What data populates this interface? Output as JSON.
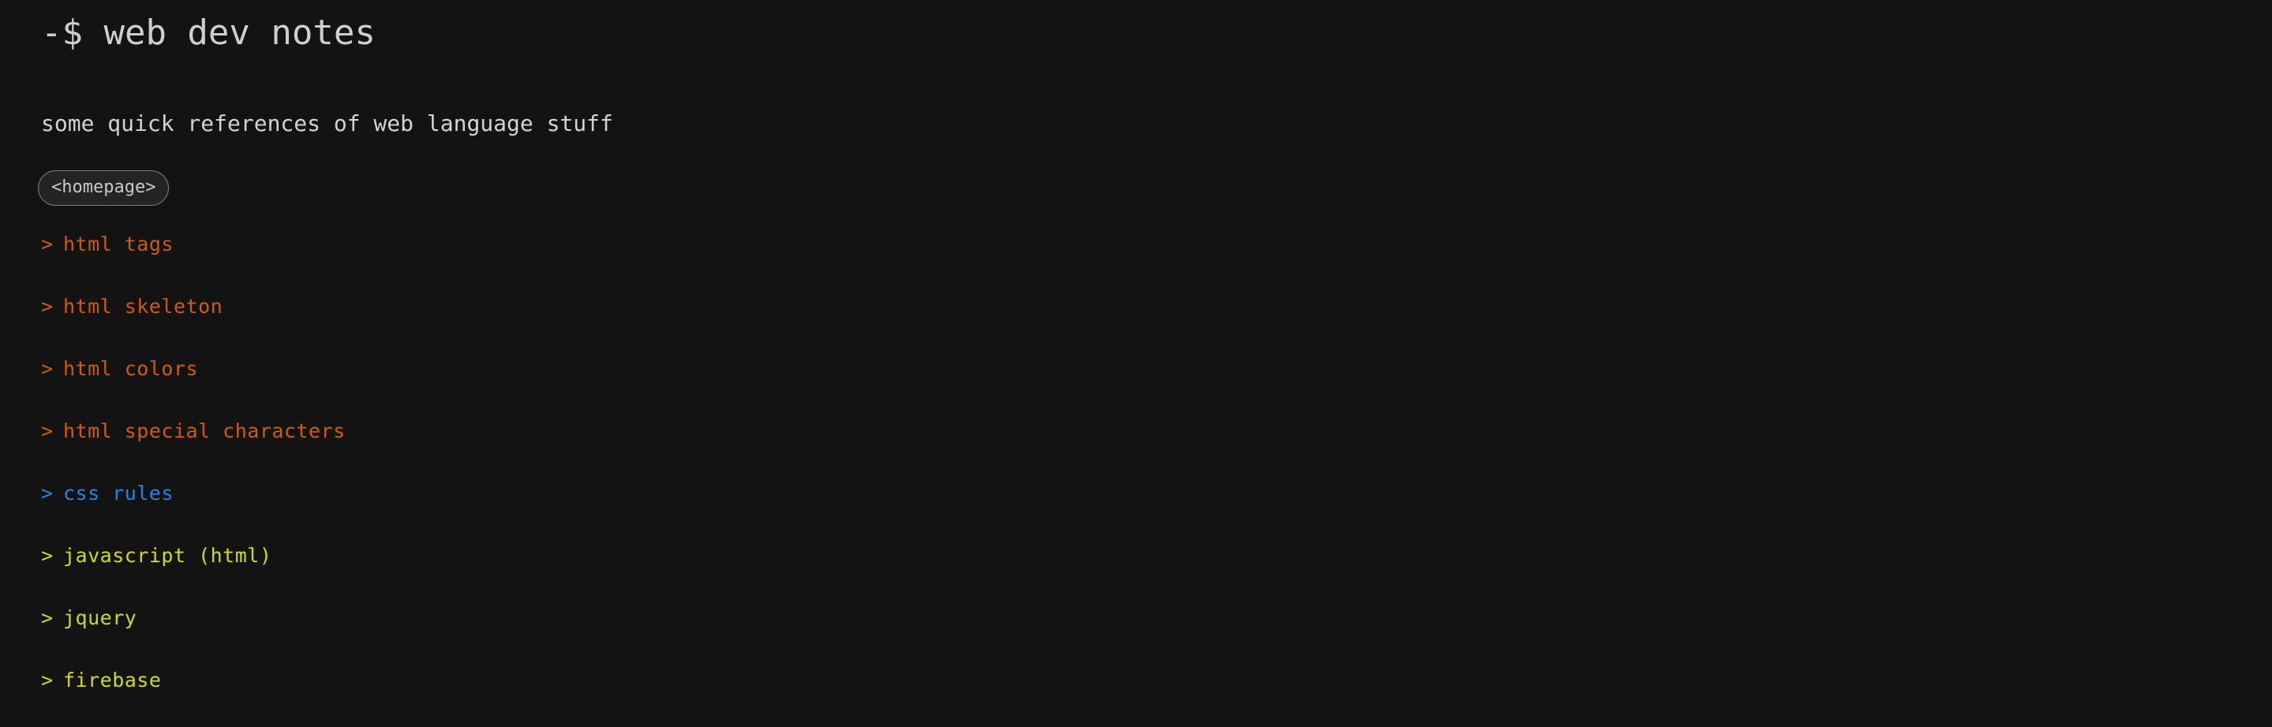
{
  "page": {
    "background_color": "#131313",
    "title": "-$ web dev notes",
    "subtitle": "some quick references of web language stuff"
  },
  "nav": {
    "homepage_label": "<homepage>"
  },
  "colors": {
    "title_text": "#cfcfcf",
    "subtitle_text": "#d3d3d3",
    "pill_border": "#7b7b7b",
    "pill_background": "#242424",
    "pill_text": "#c9c9c9",
    "orange": "#cf5c0b",
    "blue": "#1f86e6",
    "yellow": "#cede0c"
  },
  "links": {
    "marker": ">",
    "items": [
      {
        "label": "html tags",
        "color_key": "orange"
      },
      {
        "label": "html skeleton",
        "color_key": "orange"
      },
      {
        "label": "html colors",
        "color_key": "orange"
      },
      {
        "label": "html special characters",
        "color_key": "orange"
      },
      {
        "label": "css rules",
        "color_key": "blue"
      },
      {
        "label": "javascript (html)",
        "color_key": "yellow"
      },
      {
        "label": "jquery",
        "color_key": "yellow"
      },
      {
        "label": "firebase",
        "color_key": "yellow"
      }
    ]
  }
}
